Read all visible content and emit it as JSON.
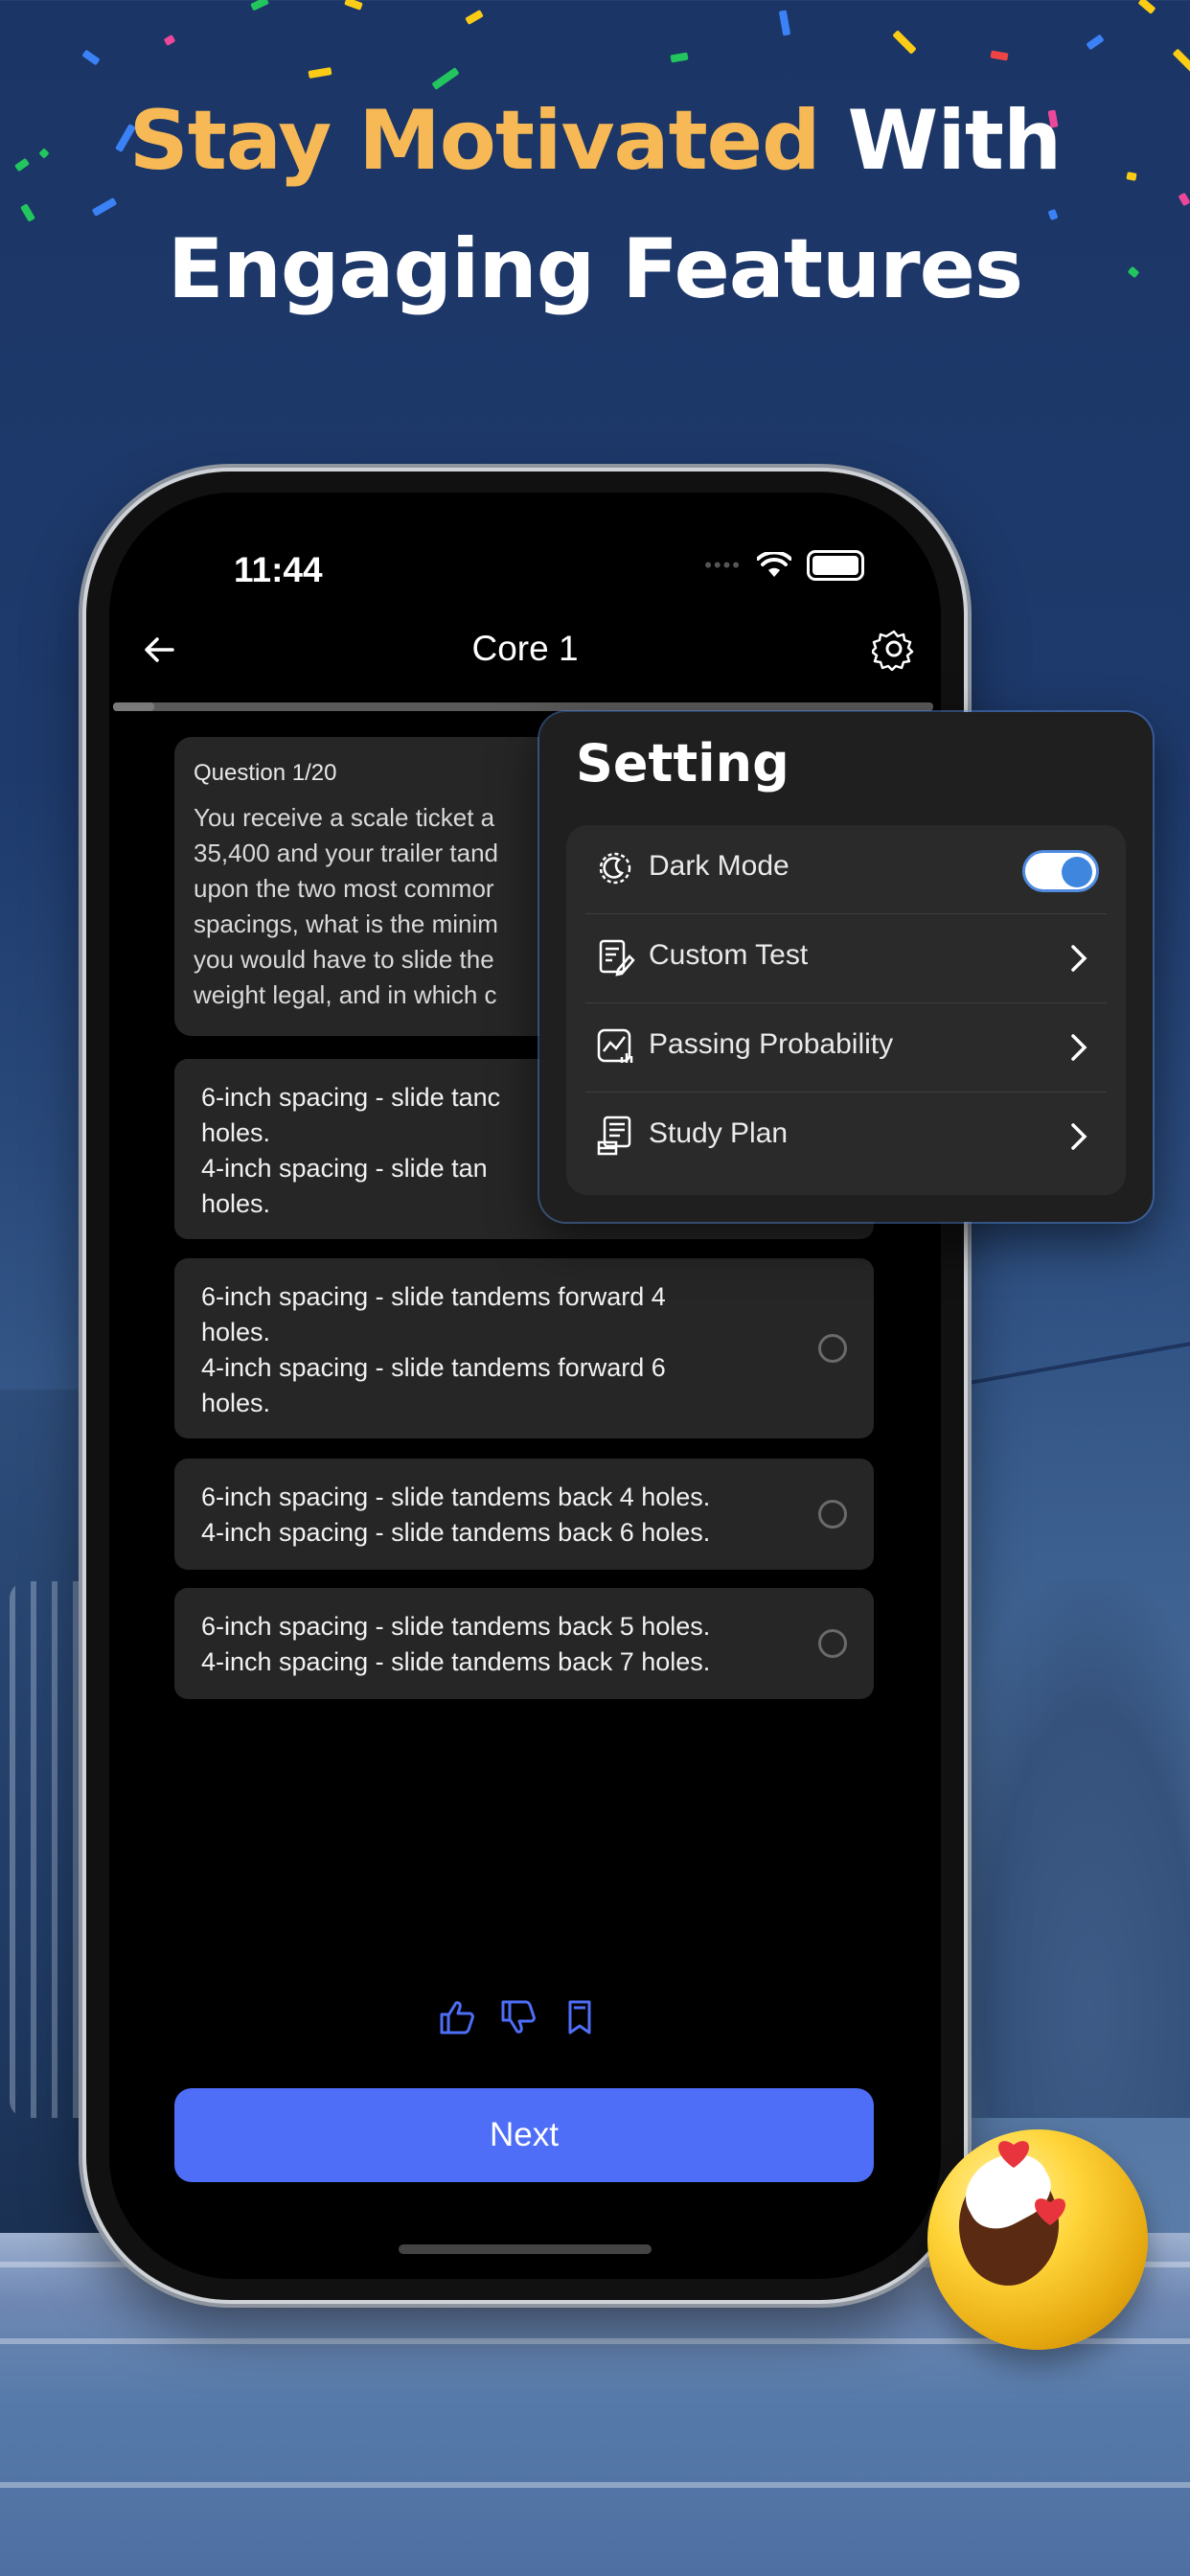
{
  "headline": {
    "line1_accent": "Stay Motivated",
    "line1_rest": "With",
    "line2": "Engaging Features"
  },
  "colors": {
    "accent": "#f7b955",
    "primary_button": "#4f6ef7",
    "toggle_on": "#3f86df"
  },
  "status_bar": {
    "time": "11:44"
  },
  "nav": {
    "title": "Core 1",
    "back_icon": "arrow-left-icon",
    "settings_icon": "gear-icon"
  },
  "progress": {
    "fraction": 0.05
  },
  "question": {
    "number": "Question 1/20",
    "text_lines": [
      "You receive a scale ticket a",
      "35,400 and your trailer tand",
      "upon the two most commor",
      "spacings, what is the minim",
      "you would have to slide the",
      "weight legal, and in which c"
    ]
  },
  "options": [
    {
      "text": "6-inch spacing - slide tanc\nholes.\n 4-inch spacing - slide tan\nholes."
    },
    {
      "text": "6-inch spacing - slide tandems forward 4\nholes.\n4-inch spacing - slide tandems forward 6\nholes."
    },
    {
      "text": "6-inch spacing - slide tandems back 4 holes.\n 4-inch spacing - slide tandems back 6 holes."
    },
    {
      "text": "6-inch spacing - slide tandems back 5 holes.\n 4-inch spacing - slide tandems back 7 holes."
    }
  ],
  "feedback_icons": [
    "thumbs-up-icon",
    "thumbs-down-icon",
    "bookmark-icon"
  ],
  "next_button": {
    "label": "Next"
  },
  "settings": {
    "title": "Setting",
    "items": [
      {
        "label": "Dark Mode",
        "icon": "dark-mode-icon",
        "control": "toggle",
        "toggle_on": true
      },
      {
        "label": "Custom Test",
        "icon": "custom-test-icon",
        "control": "chevron"
      },
      {
        "label": "Passing Probability",
        "icon": "passing-probability-icon",
        "control": "chevron"
      },
      {
        "label": "Study Plan",
        "icon": "study-plan-icon",
        "control": "chevron"
      }
    ]
  }
}
